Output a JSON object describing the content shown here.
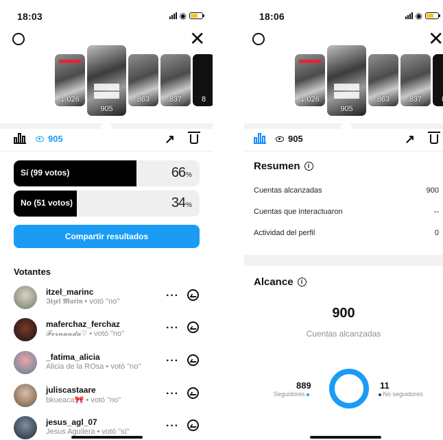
{
  "left": {
    "time": "18:03",
    "stories": [
      {
        "views": "1.026"
      },
      {
        "views": "905"
      },
      {
        "views": "863"
      },
      {
        "views": "837"
      },
      {
        "views": "8"
      }
    ],
    "toolbar": {
      "views": "905"
    },
    "poll": [
      {
        "label": "Sí (99 votos)",
        "pct": "66",
        "fill": 0.66
      },
      {
        "label": "No (51 votos)",
        "pct": "34",
        "fill": 0.34
      }
    ],
    "pct_unit": "%",
    "share_label": "Compartir resultados",
    "voters_title": "Votantes",
    "voters": [
      {
        "username": "itzel_marinc",
        "name": "𝕴𝖙𝖟𝖊𝖑 𝕸𝖆𝖗𝖎𝖓",
        "vote": " • votó \"no\""
      },
      {
        "username": "maferchaz_ferchaz",
        "name": "𝓕𝓮𝓻𝓷𝓪𝓷𝓭𝓪♡",
        "vote": " • votó \"no\""
      },
      {
        "username": "_fatima_alicia",
        "name": "Alicia de la ROsa",
        "vote": " • votó \"no\""
      },
      {
        "username": "juliscastaare",
        "name": "bkueaca🎀",
        "vote": " • votó \"no\""
      },
      {
        "username": "jesus_agl_07",
        "name": "Jesus Aguilera",
        "vote": " • votó \"sí\""
      }
    ],
    "more_label": "···"
  },
  "right": {
    "time": "18:06",
    "stories": [
      {
        "views": "1.026"
      },
      {
        "views": "905"
      },
      {
        "views": "863"
      },
      {
        "views": "837"
      },
      {
        "views": "8"
      }
    ],
    "toolbar": {
      "views": "905"
    },
    "summary_title": "Resumen",
    "summary": [
      {
        "label": "Cuentas alcanzadas",
        "value": "900"
      },
      {
        "label": "Cuentas que interactuaron",
        "value": "--"
      },
      {
        "label": "Actividad del perfil",
        "value": "0"
      }
    ],
    "reach_title": "Alcance",
    "reach_total": "900",
    "reach_label": "Cuentas alcanzadas",
    "followers_value": "889",
    "followers_label": "Seguidores",
    "nonfollowers_value": "11",
    "nonfollowers_label": "No seguidores",
    "reach_split": {
      "followers": 889,
      "nonfollowers": 11
    }
  },
  "colors": {
    "accent": "#1a9cf5",
    "bar": "#000000",
    "track": "#efefef",
    "muted": "#8e8e8e"
  }
}
